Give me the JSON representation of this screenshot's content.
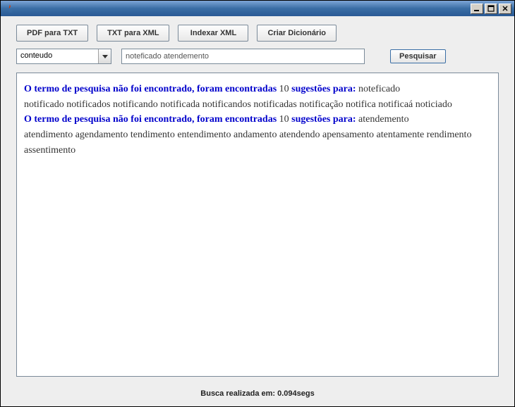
{
  "window": {
    "title": ""
  },
  "toolbar": {
    "pdf_to_txt": "PDF para TXT",
    "txt_to_xml": "TXT para XML",
    "index_xml": "Indexar XML",
    "create_dict": "Criar Dicionário"
  },
  "search": {
    "combo_selected": "conteudo",
    "query": "noteficado atendemento",
    "search_btn": "Pesquisar"
  },
  "results": {
    "notfound_prefix": "O termo de pesquisa não foi encontrado, foram encontradas ",
    "suggestions_word": " sugestões para: ",
    "items": [
      {
        "count": "10",
        "term": "noteficado",
        "suggestions": "notificado notificados notificando notificada notificandos notificadas notificação notifica notificaá noticiado"
      },
      {
        "count": "10",
        "term": "atendemento",
        "suggestions": "atendimento agendamento tendimento entendimento andamento atendendo apensamento atentamente rendimento assentimento"
      }
    ]
  },
  "status": {
    "text": "Busca realizada em: 0.094segs"
  }
}
